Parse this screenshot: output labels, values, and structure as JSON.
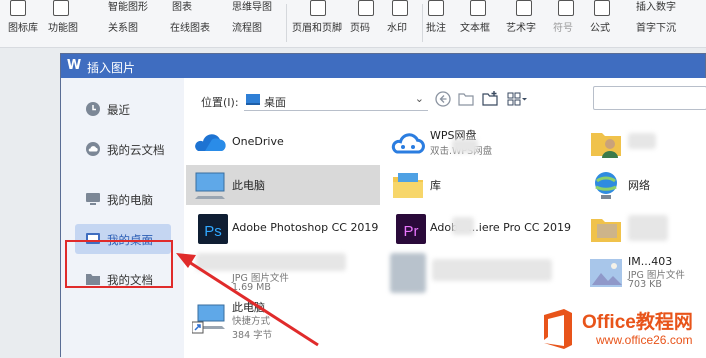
{
  "ribbon": {
    "items": [
      "图标库",
      "功能图",
      "智能图形",
      "图表",
      "思维导图",
      "关系图",
      "在线图表",
      "流程图",
      "页眉和页脚",
      "页码",
      "水印",
      "批注",
      "文本框",
      "艺术字",
      "符号",
      "公式",
      "插入数字",
      "首字下沉"
    ]
  },
  "dialog": {
    "title": "插入图片",
    "sidebar": {
      "items": [
        {
          "label": "最近",
          "icon": "clock-icon"
        },
        {
          "label": "我的云文档",
          "icon": "cloud-icon"
        },
        {
          "label": "我的电脑",
          "icon": "computer-icon"
        },
        {
          "label": "我的桌面",
          "icon": "desktop-icon",
          "active": true
        },
        {
          "label": "我的文档",
          "icon": "folder-icon"
        }
      ]
    },
    "location": {
      "label": "位置(I):",
      "value": "桌面"
    },
    "files": {
      "onedrive": {
        "name": "OneDrive"
      },
      "wps": {
        "name": "WPS网盘",
        "sub": "双击.WPS网盘"
      },
      "pc": {
        "name": "此电脑"
      },
      "lib": {
        "name": "库"
      },
      "net": {
        "name": "网络"
      },
      "ps": {
        "name": "Adobe Photoshop CC 2019"
      },
      "pr": {
        "name": "Adobe ...iere Pro CC 2019"
      },
      "jpg1": {
        "name": "JPG 图片文件",
        "sub": "1.69 MB"
      },
      "img": {
        "name": "IM...403",
        "sub": "JPG 图片文件",
        "size": "703 KB"
      },
      "shortcut": {
        "name": "此电脑",
        "sub": "快捷方式",
        "size": "384 字节"
      }
    }
  },
  "watermark": {
    "brand": "Office教程网",
    "url": "www.office26.com",
    "color": "#e8541a"
  },
  "colors": {
    "titlebar": "#3f6dc0",
    "highlight": "#e02b2b",
    "arrow": "#e02b2b"
  }
}
